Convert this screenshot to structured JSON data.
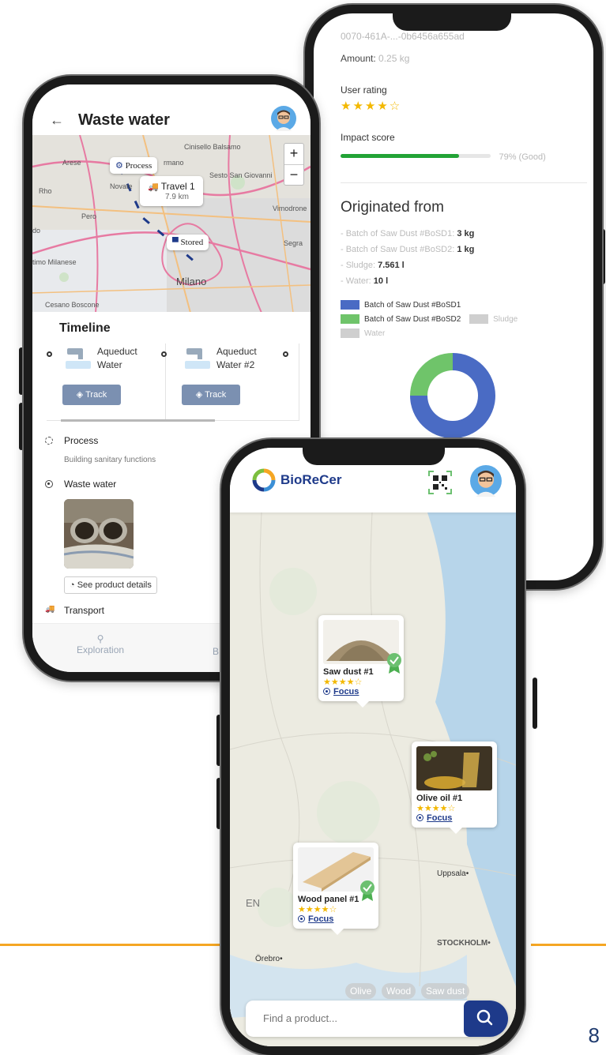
{
  "page_number": "8",
  "stats_phone": {
    "id_text": "0070-461A-...-0b6456a655ad",
    "amount_label": "Amount:",
    "amount_value": "0.25 kg",
    "rating_label": "User rating",
    "rating_stars": "★★★★☆",
    "impact_label": "Impact score",
    "impact_fraction": 0.79,
    "impact_text": "79% (Good)",
    "originated_title": "Originated from",
    "origins": [
      {
        "label": "- Batch of Saw Dust #BoSD1:",
        "value": "3 kg"
      },
      {
        "label": "- Batch of Saw Dust #BoSD2:",
        "value": "1 kg"
      },
      {
        "label": "- Sludge:",
        "value": "7.561 l"
      },
      {
        "label": "- Water:",
        "value": "10 l"
      }
    ],
    "legend": [
      {
        "label": "Batch of Saw Dust #BoSD1",
        "color": "#4a6bc4"
      },
      {
        "label": "Batch of Saw Dust #BoSD2",
        "color": "#6fc46a"
      },
      {
        "label": "Sludge",
        "color": "#cfcfcf"
      },
      {
        "label": "Water",
        "color": "#cfcfcf"
      }
    ]
  },
  "chart_data": {
    "type": "pie",
    "categories": [
      "Batch of Saw Dust #BoSD1",
      "Batch of Saw Dust #BoSD2",
      "Sludge",
      "Water"
    ],
    "values": [
      75,
      25,
      0,
      0
    ],
    "colors": [
      "#4a6bc4",
      "#6fc46a",
      "#cfcfcf",
      "#cfcfcf"
    ],
    "donut": true
  },
  "waste_phone": {
    "title": "Waste water",
    "back_icon": "arrow-left-icon",
    "map": {
      "popups": {
        "process": "Process",
        "travel": "Travel 1",
        "travel_distance": "7.9 km",
        "stored": "Stored"
      },
      "cities": [
        "Arese",
        "Cinisello Balsamo",
        "Rho",
        "Novate",
        "Sesto San Giovanni",
        "Pero",
        "Vimodrone",
        "Segra",
        "timo Milanese",
        "Milano",
        "Cesano Boscone",
        "rmano",
        "do"
      ],
      "zoom_in": "+",
      "zoom_out": "−"
    },
    "timeline_title": "Timeline",
    "cards": [
      {
        "name_line1": "Aqueduct",
        "name_line2": "Water",
        "track": "Track"
      },
      {
        "name_line1": "Aqueduct",
        "name_line2": "Water #2",
        "track": "Track"
      }
    ],
    "steps": [
      {
        "label": "Process",
        "sub": "Building sanitary functions"
      },
      {
        "label": "Waste water"
      },
      {
        "label": "Transport"
      }
    ],
    "details_button": "See product details",
    "nav": {
      "exploration": "Exploration",
      "second": "B"
    }
  },
  "front_phone": {
    "brand": "BioReCer",
    "products": [
      {
        "name": "Saw dust #1",
        "stars": "★★★★☆",
        "focus": "Focus"
      },
      {
        "name": "Olive oil #1",
        "stars": "★★★★☆",
        "focus": "Focus"
      },
      {
        "name": "Wood panel #1",
        "stars": "★★★★☆",
        "focus": "Focus"
      }
    ],
    "map_labels": {
      "uppsala": "Uppsala•",
      "stockholm": "STOCKHOLM•",
      "orebro": "Örebro•",
      "en": "EN"
    },
    "chips": [
      "Olive",
      "Wood",
      "Saw dust"
    ],
    "search_placeholder": "Find a product..."
  }
}
